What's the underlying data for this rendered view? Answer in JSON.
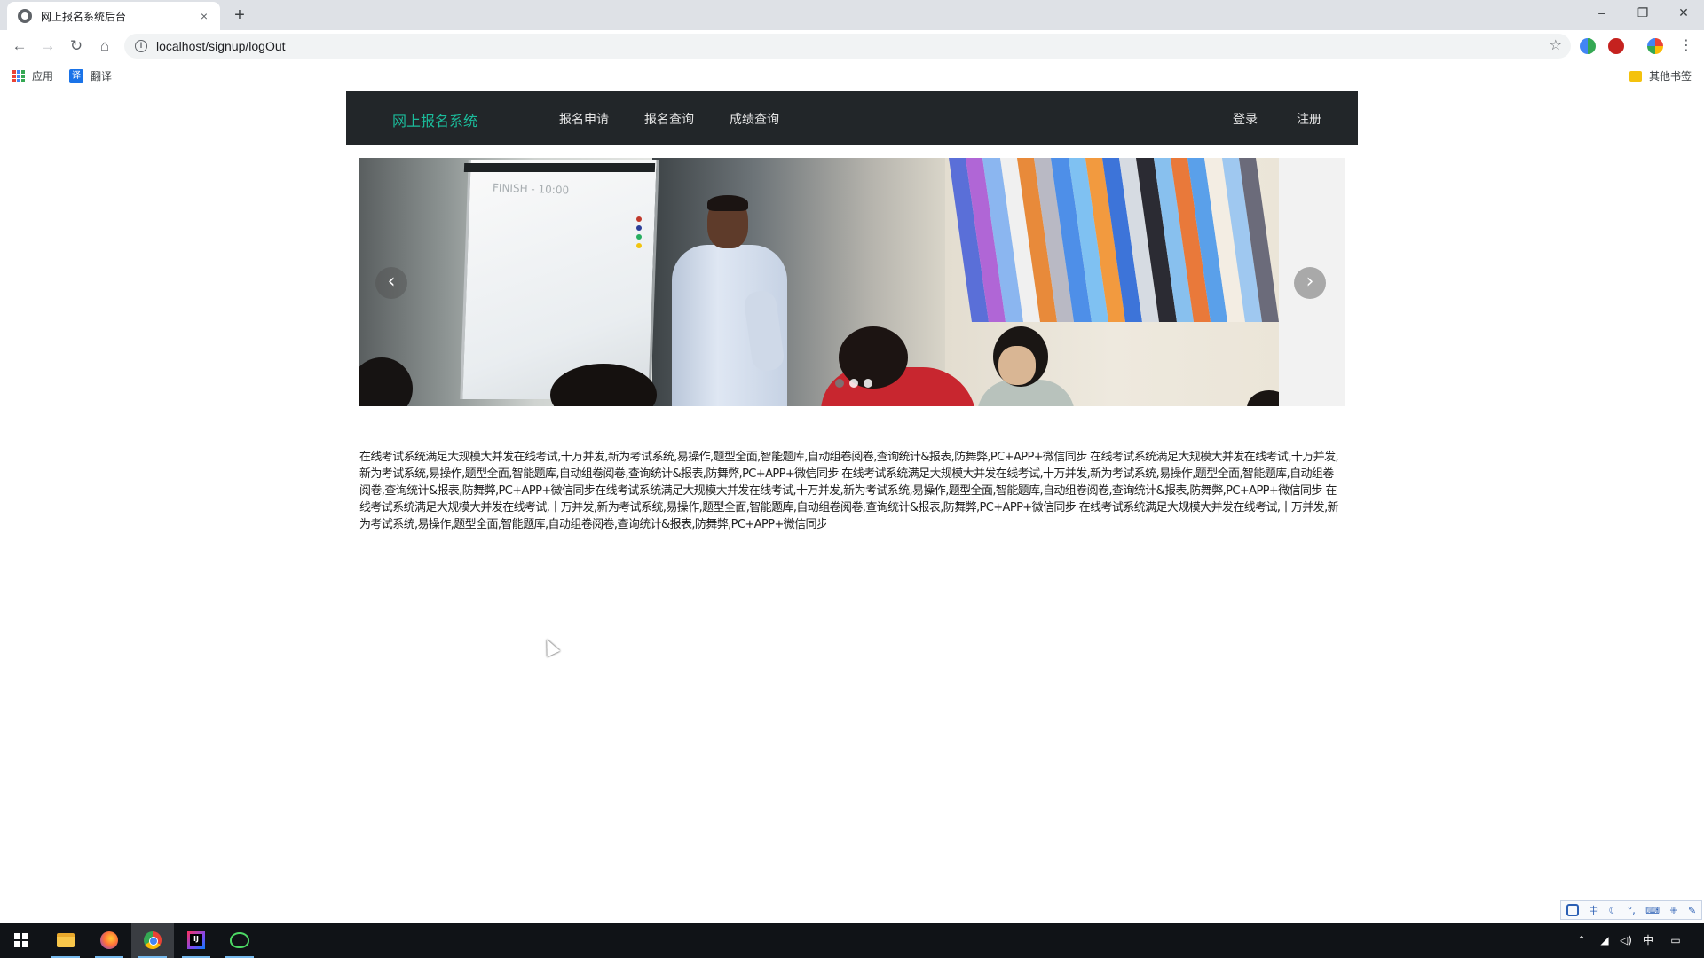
{
  "browser": {
    "tab_title": "网上报名系统后台",
    "tab_close": "×",
    "new_tab": "+",
    "url": "localhost/signup/logOut",
    "window_controls": {
      "minimize": "–",
      "restore": "❐",
      "close": "✕"
    },
    "nav": {
      "back": "←",
      "forward": "→",
      "reload": "↻",
      "home": "⌂"
    },
    "star": "☆",
    "menu": "⋮",
    "bookmarks": [
      {
        "label": "应用"
      },
      {
        "label": "翻译"
      }
    ],
    "other_bookmarks": "其他书签"
  },
  "site": {
    "brand": "网上报名系统",
    "nav": [
      "报名申请",
      "报名查询",
      "成绩查询"
    ],
    "auth": {
      "login": "登录",
      "register": "注册"
    },
    "carousel": {
      "board_text": "FINISH - 10:00",
      "prev": "‹",
      "next": "›",
      "slide_count": 3,
      "active_index": 0
    },
    "intro": "在线考试系统满足大规模大并发在线考试,十万并发,新为考试系统,易操作,题型全面,智能题库,自动组卷阅卷,查询统计&报表,防舞弊,PC+APP+微信同步 在线考试系统满足大规模大并发在线考试,十万并发,新为考试系统,易操作,题型全面,智能题库,自动组卷阅卷,查询统计&报表,防舞弊,PC+APP+微信同步 在线考试系统满足大规模大并发在线考试,十万并发,新为考试系统,易操作,题型全面,智能题库,自动组卷阅卷,查询统计&报表,防舞弊,PC+APP+微信同步在线考试系统满足大规模大并发在线考试,十万并发,新为考试系统,易操作,题型全面,智能题库,自动组卷阅卷,查询统计&报表,防舞弊,PC+APP+微信同步 在线考试系统满足大规模大并发在线考试,十万并发,新为考试系统,易操作,题型全面,智能题库,自动组卷阅卷,查询统计&报表,防舞弊,PC+APP+微信同步 在线考试系统满足大规模大并发在线考试,十万并发,新为考试系统,易操作,题型全面,智能题库,自动组卷阅卷,查询统计&报表,防舞弊,PC+APP+微信同步"
  },
  "system": {
    "ime_lang": "中",
    "tray_lang": "中"
  },
  "colors": {
    "nav_bg": "#222629",
    "brand": "#1bbc9b",
    "taskbar": "#101317"
  },
  "icons": [
    "site-favicon-icon",
    "info-icon",
    "star-icon",
    "apps-icon",
    "translate-icon",
    "folder-icon",
    "windows-start-icon",
    "file-explorer-icon",
    "firefox-icon",
    "chrome-icon",
    "intellij-icon",
    "frog-app-icon"
  ]
}
